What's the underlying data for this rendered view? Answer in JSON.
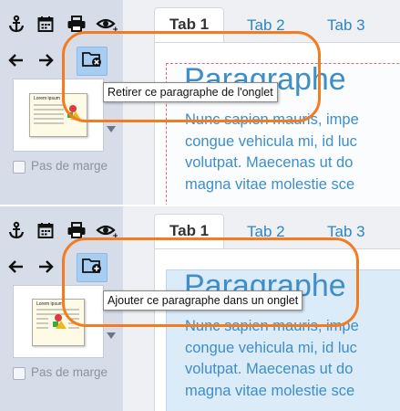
{
  "colors": {
    "accent": "#2e86c1",
    "highlight": "#f47b20",
    "active_button": "#a8cdf3"
  },
  "panels": [
    {
      "toolbar": {
        "row1": [
          "anchor-icon",
          "calendar-icon",
          "printer-icon",
          "eye-icon"
        ],
        "row2": [
          "arrow-left-icon",
          "arrow-right-icon"
        ],
        "active_icon": "remove-from-tab-icon"
      },
      "thumbnail": {
        "title": "Lorem ipsum",
        "dropdown_icon": "caret-down-icon"
      },
      "checkbox": {
        "label": "Pas de marge",
        "checked": false
      },
      "tabs": [
        "Tab 1",
        "Tab 2",
        "Tab 3"
      ],
      "selected_tab": "Tab 1",
      "tooltip": "Retirer ce paragraphe de l'onglet",
      "paragraph": {
        "heading": "Paragraphe",
        "lines": [
          "Nunc sapien mauris, impe",
          "congue vehicula mi, id luc",
          "volutpat. Maecenas ut do",
          "magna vitae molestie sce"
        ]
      }
    },
    {
      "toolbar": {
        "row1": [
          "anchor-icon",
          "calendar-icon",
          "printer-icon",
          "eye-icon"
        ],
        "row2": [
          "arrow-left-icon",
          "arrow-right-icon"
        ],
        "active_icon": "add-to-tab-icon"
      },
      "thumbnail": {
        "title": "Lorem ipsum",
        "dropdown_icon": "caret-down-icon"
      },
      "checkbox": {
        "label": "Pas de marge",
        "checked": false
      },
      "tabs": [
        "Tab 1",
        "Tab 2",
        "Tab 3"
      ],
      "selected_tab": "Tab 1",
      "tooltip": "Ajouter ce paragraphe dans un onglet",
      "paragraph": {
        "heading": "Paragraphe",
        "lines": [
          "Nunc sapien mauris, impe",
          "congue vehicula mi, id luc",
          "volutpat. Maecenas ut do",
          "magna vitae molestie sce"
        ]
      }
    }
  ]
}
